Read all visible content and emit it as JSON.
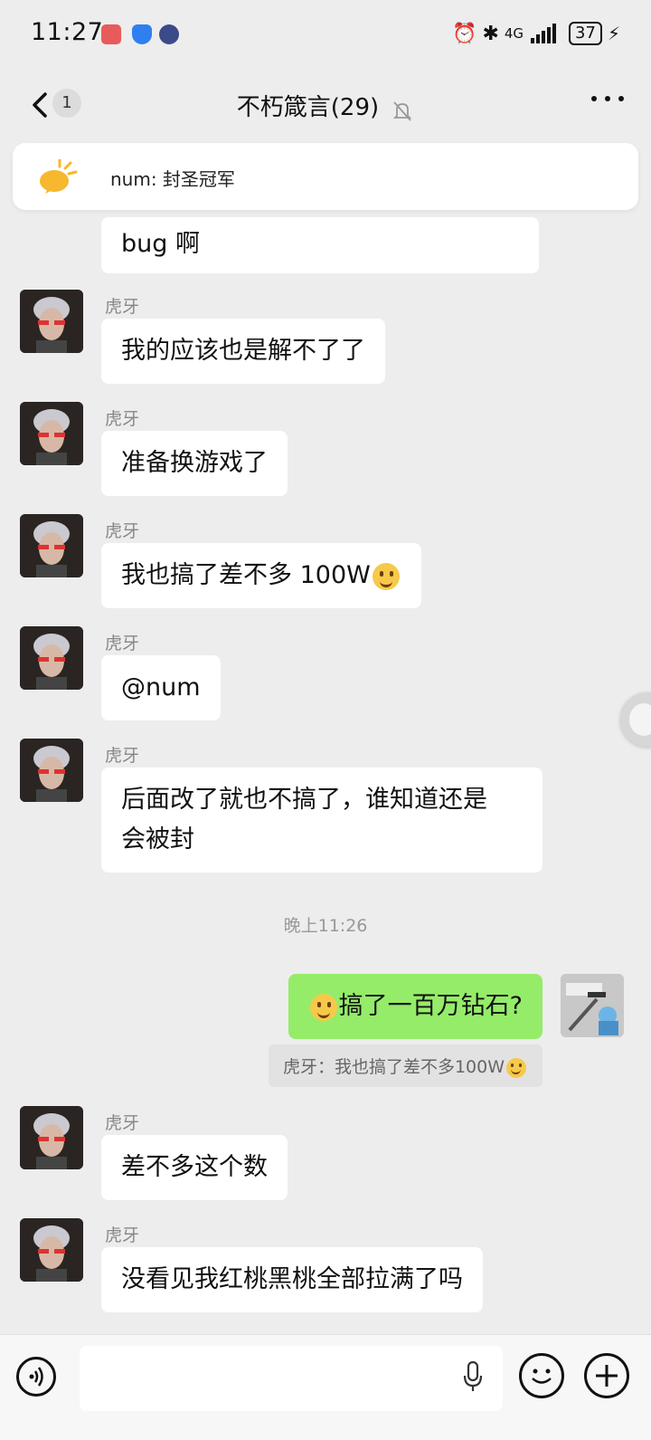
{
  "status_bar": {
    "time": "11:27",
    "network": "4G",
    "battery": "37"
  },
  "header": {
    "back_badge": "1",
    "title": "不朽箴言(29)"
  },
  "pinned": {
    "text": "num: 封圣冠军"
  },
  "messages": [
    {
      "sender": "",
      "text": "bug 啊"
    },
    {
      "sender": "虎牙",
      "text": "我的应该也是解不了了"
    },
    {
      "sender": "虎牙",
      "text": "准备换游戏了"
    },
    {
      "sender": "虎牙",
      "text": "我也搞了差不多 100W"
    },
    {
      "sender": "虎牙",
      "text": "@num"
    },
    {
      "sender": "虎牙",
      "text_line1": "后面改了就也不搞了，谁知道还是",
      "text_line2": "会被封"
    },
    {
      "sender": "虎牙",
      "text": "差不多这个数"
    },
    {
      "sender": "虎牙",
      "text": "没看见我红桃黑桃全部拉满了吗"
    }
  ],
  "timestamp": "晚上11:26",
  "my_message": {
    "text": "搞了一百万钻石?"
  },
  "quote": {
    "text": "虎牙：我也搞了差不多100W"
  },
  "input": {
    "placeholder": ""
  }
}
